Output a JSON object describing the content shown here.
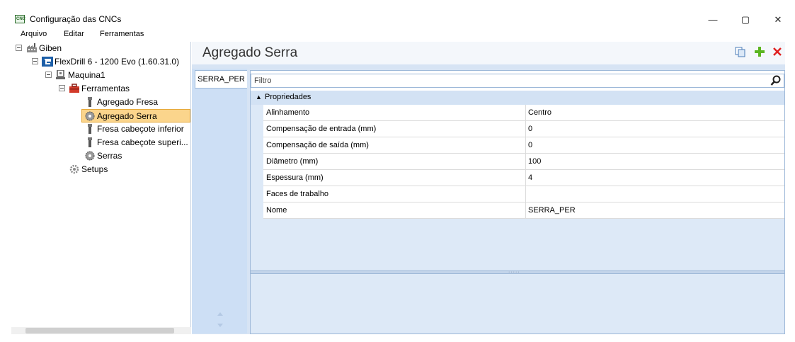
{
  "window": {
    "title": "Configuração das CNCs",
    "app_icon_text": "CNC",
    "minimize_glyph": "—",
    "maximize_glyph": "▢",
    "close_glyph": "✕"
  },
  "menu": {
    "items": [
      "Arquivo",
      "Editar",
      "Ferramentas"
    ]
  },
  "tree": {
    "nodes": [
      {
        "label": "Giben",
        "icon": "factory-icon"
      },
      {
        "label": "FlexDrill 6 - 1200 Evo (1.60.31.0)",
        "icon": "machine-logo-icon"
      },
      {
        "label": "Maquina1",
        "icon": "machine-icon"
      },
      {
        "label": "Ferramentas",
        "icon": "toolbox-icon"
      },
      {
        "label": "Agregado Fresa",
        "icon": "drill-bit-icon"
      },
      {
        "label": "Agregado Serra",
        "icon": "saw-blade-icon",
        "selected": true
      },
      {
        "label": "Fresa cabeçote inferior",
        "icon": "drill-bit-icon"
      },
      {
        "label": "Fresa cabeçote superi...",
        "icon": "drill-bit-icon"
      },
      {
        "label": "Serras",
        "icon": "saw-blade-icon"
      },
      {
        "label": "Setups",
        "icon": "gear-icon"
      }
    ]
  },
  "main": {
    "title": "Agregado Serra",
    "tab_active": "SERRA_PER",
    "filter_placeholder": "Filtro",
    "category": "Propriedades",
    "properties": [
      {
        "name": "Alinhamento",
        "value": "Centro"
      },
      {
        "name": "Compensação de entrada (mm)",
        "value": "0"
      },
      {
        "name": "Compensação de saída (mm)",
        "value": "0"
      },
      {
        "name": "Diâmetro (mm)",
        "value": "100"
      },
      {
        "name": "Espessura (mm)",
        "value": "4"
      },
      {
        "name": "Faces de trabalho",
        "value": ""
      },
      {
        "name": "Nome",
        "value": "SERRA_PER"
      }
    ]
  },
  "colors": {
    "selection": "#fbd58c",
    "accent": "#d7e4f4",
    "add": "#5bb520",
    "delete": "#e02020"
  }
}
